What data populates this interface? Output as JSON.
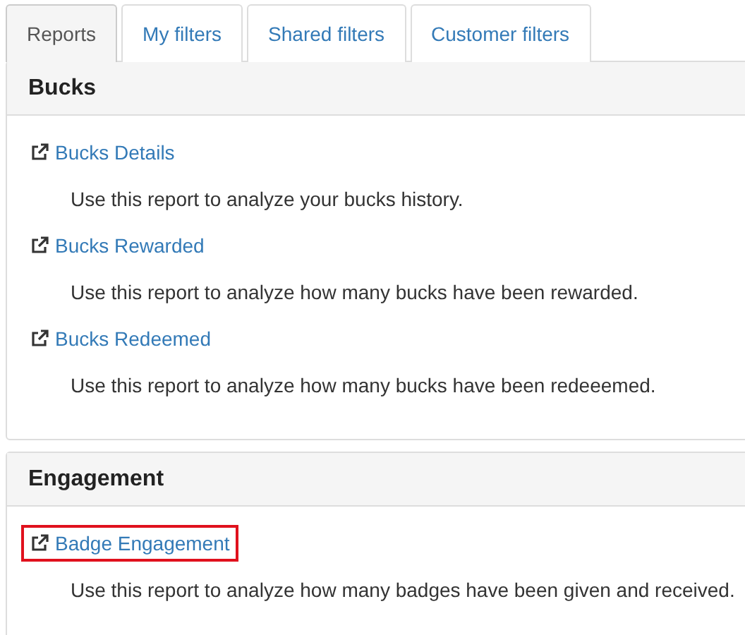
{
  "tabs": [
    {
      "label": "Reports",
      "selected": true
    },
    {
      "label": "My filters",
      "selected": false
    },
    {
      "label": "Shared filters",
      "selected": false
    },
    {
      "label": "Customer filters",
      "selected": false
    }
  ],
  "panels": [
    {
      "title": "Bucks",
      "reports": [
        {
          "name": "Bucks Details",
          "description": "Use this report to analyze your bucks history.",
          "highlighted": false
        },
        {
          "name": "Bucks Rewarded",
          "description": "Use this report to analyze how many bucks have been rewarded.",
          "highlighted": false
        },
        {
          "name": "Bucks Redeemed",
          "description": "Use this report to analyze how many bucks have been redeeemed.",
          "highlighted": false
        }
      ]
    },
    {
      "title": "Engagement",
      "reports": [
        {
          "name": "Badge Engagement",
          "description": "Use this report to analyze how many badges have been given and received.",
          "highlighted": true
        }
      ]
    }
  ]
}
